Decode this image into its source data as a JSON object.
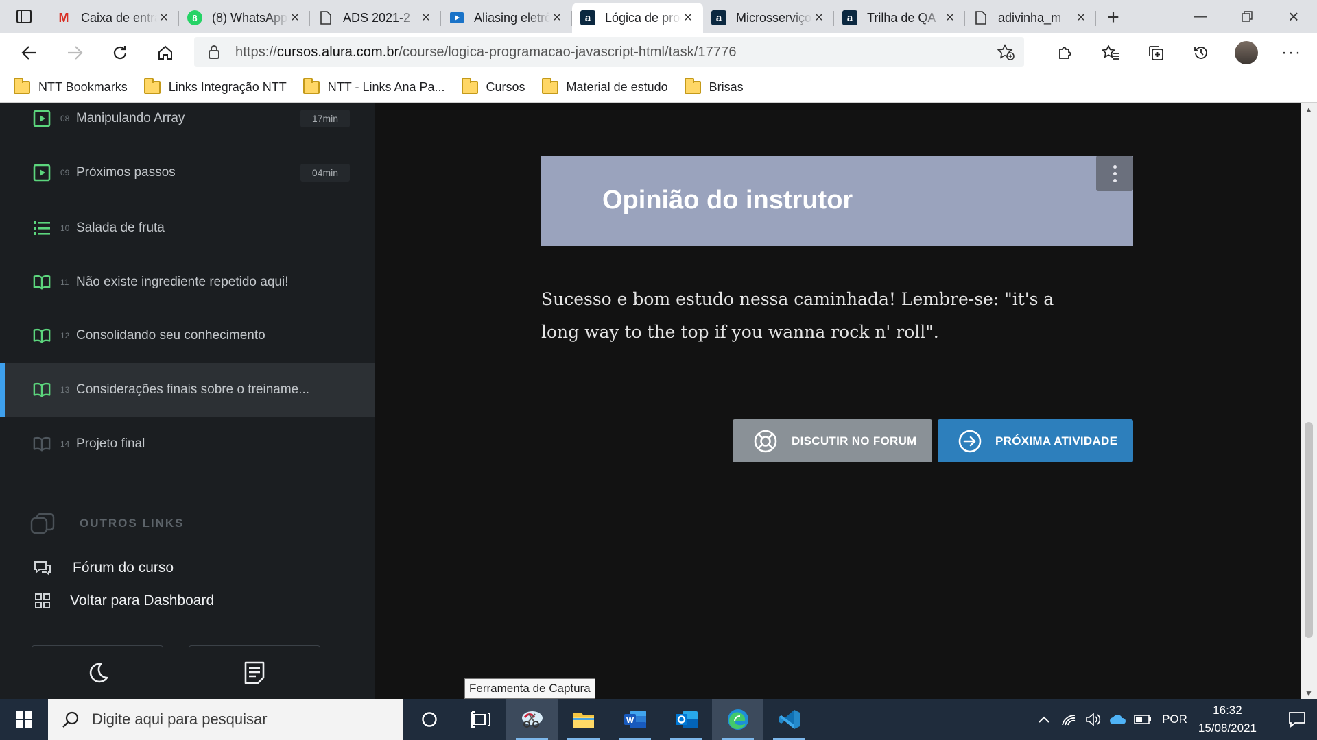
{
  "browser": {
    "tabs": [
      {
        "title": "Caixa de entrada",
        "favicon": "gmail-icon",
        "active": false
      },
      {
        "title": "(8) WhatsApp",
        "favicon": "whatsapp-icon",
        "active": false
      },
      {
        "title": "ADS 2021-2",
        "favicon": "page-icon",
        "active": false
      },
      {
        "title": "Aliasing eletrônico",
        "favicon": "video-icon",
        "active": false
      },
      {
        "title": "Lógica de programação",
        "favicon": "alura-icon",
        "active": true
      },
      {
        "title": "Microsserviços",
        "favicon": "alura-icon",
        "active": false
      },
      {
        "title": "Trilha de QA",
        "favicon": "alura-icon",
        "active": false
      },
      {
        "title": "adivinha_m",
        "favicon": "page-icon",
        "active": false
      }
    ],
    "url_prefix": "https://",
    "url_domain": "cursos.alura.com.br",
    "url_path": "/course/logica-programacao-javascript-html/task/17776",
    "bookmarks": [
      "NTT Bookmarks",
      "Links Integração NTT",
      "NTT - Links Ana Pa...",
      "Cursos",
      "Material de estudo",
      "Brisas"
    ]
  },
  "sidebar": {
    "lessons": [
      {
        "num": "08",
        "label": "Manipulando Array",
        "duration": "17min",
        "icon": "video-play-icon",
        "state": "done"
      },
      {
        "num": "09",
        "label": "Próximos passos",
        "duration": "04min",
        "icon": "video-play-icon",
        "state": "done"
      },
      {
        "num": "10",
        "label": "Salada de fruta",
        "duration": "",
        "icon": "list-icon",
        "state": "done"
      },
      {
        "num": "11",
        "label": "Não existe ingrediente repetido aqui!",
        "duration": "",
        "icon": "book-icon",
        "state": "done"
      },
      {
        "num": "12",
        "label": "Consolidando seu conhecimento",
        "duration": "",
        "icon": "book-icon",
        "state": "done"
      },
      {
        "num": "13",
        "label": "Considerações finais sobre o treiname...",
        "duration": "",
        "icon": "book-icon",
        "state": "current"
      },
      {
        "num": "14",
        "label": "Projeto final",
        "duration": "",
        "icon": "book-icon",
        "state": "pending"
      }
    ],
    "other_links_title": "OUTROS LINKS",
    "forum_link": "Fórum do curso",
    "dashboard_link": "Voltar para Dashboard"
  },
  "content": {
    "section_title": "Opinião do instrutor",
    "opinion_text": "Sucesso e bom estudo nessa caminhada! Lembre-se: \"it's a long way to the top if you wanna rock n' roll\".",
    "forum_button": "DISCUTIR NO FORUM",
    "next_button": "PRÓXIMA ATIVIDADE"
  },
  "taskbar": {
    "search_placeholder": "Digite aqui para pesquisar",
    "tooltip": "Ferramenta de Captura",
    "language": "POR",
    "time": "16:32",
    "date": "15/08/2021"
  },
  "colors": {
    "sidebar_bg": "#1b1e21",
    "content_bg": "#121212",
    "banner_bg": "#9aa3bd",
    "done_green": "#5cd67d",
    "current_accent": "#3ea0ed",
    "next_button": "#2d7fbc",
    "forum_button": "#8a9197",
    "taskbar_bg": "#1f2c3c"
  }
}
